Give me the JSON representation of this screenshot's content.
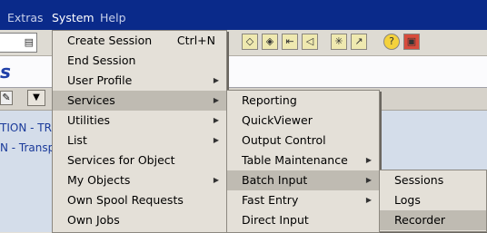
{
  "menubar": {
    "items": [
      {
        "label": "Extras"
      },
      {
        "label": "System"
      },
      {
        "label": "Help"
      }
    ]
  },
  "content": {
    "lines": [
      "TION - TR C",
      "N - Transpo"
    ]
  },
  "system_menu": {
    "items": [
      {
        "label": "Create Session",
        "shortcut": "Ctrl+N"
      },
      {
        "label": "End Session"
      },
      {
        "label": "User Profile"
      },
      {
        "label": "Services"
      },
      {
        "label": "Utilities"
      },
      {
        "label": "List"
      },
      {
        "label": "Services for Object"
      },
      {
        "label": "My Objects"
      },
      {
        "label": "Own Spool Requests"
      },
      {
        "label": "Own Jobs"
      }
    ]
  },
  "services_menu": {
    "items": [
      {
        "label": "Reporting"
      },
      {
        "label": "QuickViewer"
      },
      {
        "label": "Output Control"
      },
      {
        "label": "Table Maintenance"
      },
      {
        "label": "Batch Input"
      },
      {
        "label": "Fast Entry"
      },
      {
        "label": "Direct Input"
      }
    ]
  },
  "batch_input_menu": {
    "items": [
      {
        "label": "Sessions"
      },
      {
        "label": "Logs"
      },
      {
        "label": "Recorder"
      }
    ]
  }
}
